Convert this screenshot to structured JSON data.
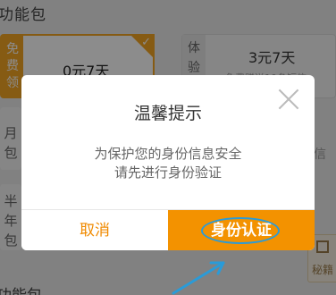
{
  "background": {
    "section_title": "功能包",
    "free_card": {
      "side": "免\n费\n领",
      "price": "0元7天"
    },
    "exp_card": {
      "side": "体\n验",
      "price": "3元7天",
      "sub": "免费赠送10条短信"
    },
    "month_card": {
      "side": "月\n包"
    },
    "half_card": {
      "side": "半\n年\n包"
    },
    "right_frag": "信",
    "bottom_frag": "功能包",
    "secret_label": "秘籍"
  },
  "dialog": {
    "title": "温馨提示",
    "message_line1": "为保护您的身份信息安全",
    "message_line2": "请先进行身份验证",
    "cancel_label": "取消",
    "verify_label": "身份认证"
  },
  "colors": {
    "accent": "#f39200",
    "cancel_text": "#f08a00",
    "annotation": "#2a9bd8"
  }
}
